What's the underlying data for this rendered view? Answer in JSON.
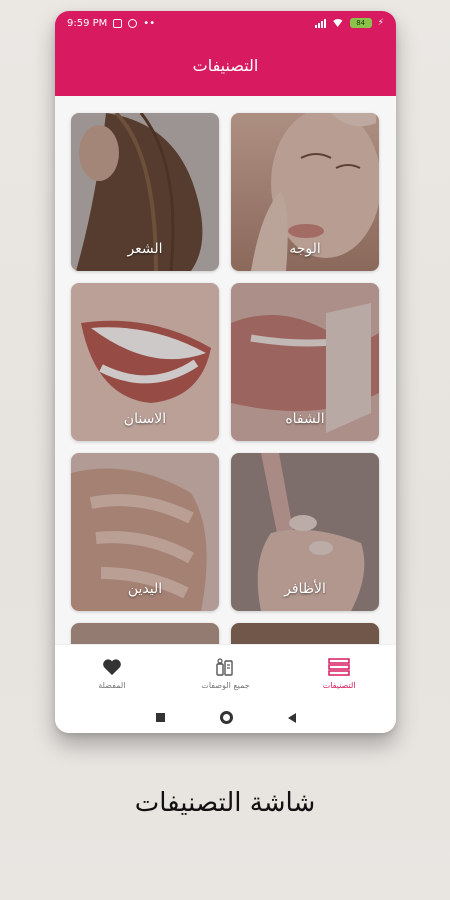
{
  "status_bar": {
    "time": "9:59 PM",
    "battery": "84"
  },
  "app_bar": {
    "title": "التصنيفات"
  },
  "categories": [
    {
      "label": "الوجه"
    },
    {
      "label": "الشعر"
    },
    {
      "label": "الشفاه"
    },
    {
      "label": "الاسنان"
    },
    {
      "label": "الأظافر"
    },
    {
      "label": "اليدين"
    }
  ],
  "bottom_nav": {
    "items": [
      {
        "label": "التصنيفات",
        "icon": "categories-icon",
        "active": true
      },
      {
        "label": "جميع الوصفات",
        "icon": "recipes-icon",
        "active": false
      },
      {
        "label": "المفضلة",
        "icon": "heart-icon",
        "active": false
      }
    ]
  },
  "caption": "شاشة التصنيفات",
  "colors": {
    "primary": "#d81b60",
    "active_nav": "#d81b60",
    "inactive_nav": "#777777"
  }
}
